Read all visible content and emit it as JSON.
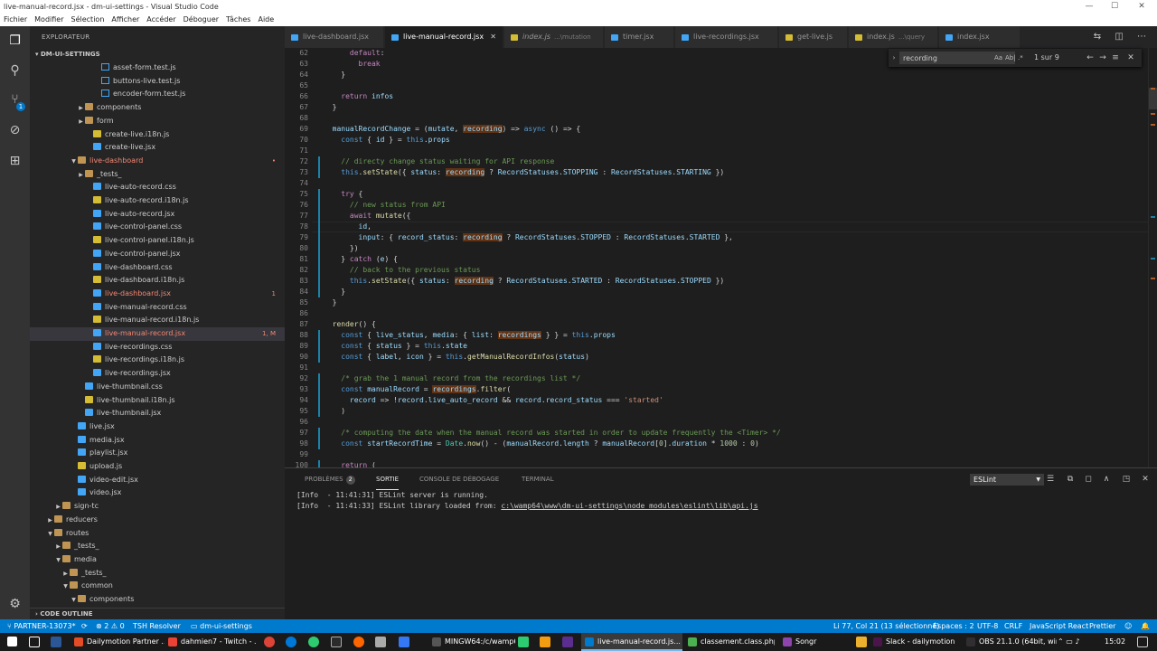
{
  "window": {
    "title": "live-manual-record.jsx - dm-ui-settings - Visual Studio Code",
    "minimize": "—",
    "maximize": "☐",
    "close": "✕"
  },
  "menu": [
    "Fichier",
    "Modifier",
    "Sélection",
    "Afficher",
    "Accéder",
    "Déboguer",
    "Tâches",
    "Aide"
  ],
  "activity": {
    "scm_badge": "1"
  },
  "sidebar": {
    "title": "EXPLORATEUR",
    "section": "DM-UI-SETTINGS",
    "outline": "CODE OUTLINE",
    "items": [
      {
        "label": "asset-form.test.js",
        "type": "test",
        "status": ""
      },
      {
        "label": "buttons-live.test.js",
        "type": "test",
        "status": ""
      },
      {
        "label": "encoder-form.test.js",
        "type": "test",
        "status": ""
      },
      {
        "label": "components",
        "type": "folder",
        "status": ""
      },
      {
        "label": "form",
        "type": "folder",
        "status": ""
      },
      {
        "label": "create-live.i18n.js",
        "type": "js",
        "status": ""
      },
      {
        "label": "create-live.jsx",
        "type": "css",
        "status": ""
      },
      {
        "label": "live-dashboard",
        "type": "folder",
        "status": "•"
      },
      {
        "label": "_tests_",
        "type": "folder",
        "status": ""
      },
      {
        "label": "live-auto-record.css",
        "type": "css",
        "status": ""
      },
      {
        "label": "live-auto-record.i18n.js",
        "type": "js",
        "status": ""
      },
      {
        "label": "live-auto-record.jsx",
        "type": "css",
        "status": ""
      },
      {
        "label": "live-control-panel.css",
        "type": "css",
        "status": ""
      },
      {
        "label": "live-control-panel.i18n.js",
        "type": "js",
        "status": ""
      },
      {
        "label": "live-control-panel.jsx",
        "type": "css",
        "status": ""
      },
      {
        "label": "live-dashboard.css",
        "type": "css",
        "status": ""
      },
      {
        "label": "live-dashboard.i18n.js",
        "type": "js",
        "status": ""
      },
      {
        "label": "live-dashboard.jsx",
        "type": "css",
        "status": "1"
      },
      {
        "label": "live-manual-record.css",
        "type": "css",
        "status": ""
      },
      {
        "label": "live-manual-record.i18n.js",
        "type": "js",
        "status": ""
      },
      {
        "label": "live-manual-record.jsx",
        "type": "css",
        "status": "1, M"
      },
      {
        "label": "live-recordings.css",
        "type": "css",
        "status": ""
      },
      {
        "label": "live-recordings.i18n.js",
        "type": "js",
        "status": ""
      },
      {
        "label": "live-recordings.jsx",
        "type": "css",
        "status": ""
      },
      {
        "label": "live-thumbnail.css",
        "type": "css",
        "status": ""
      },
      {
        "label": "live-thumbnail.i18n.js",
        "type": "js",
        "status": ""
      },
      {
        "label": "live-thumbnail.jsx",
        "type": "css",
        "status": ""
      },
      {
        "label": "live.jsx",
        "type": "css",
        "status": ""
      },
      {
        "label": "media.jsx",
        "type": "css",
        "status": ""
      },
      {
        "label": "playlist.jsx",
        "type": "css",
        "status": ""
      },
      {
        "label": "upload.js",
        "type": "js",
        "status": ""
      },
      {
        "label": "video-edit.jsx",
        "type": "css",
        "status": ""
      },
      {
        "label": "video.jsx",
        "type": "css",
        "status": ""
      },
      {
        "label": "sign-tc",
        "type": "folder",
        "status": ""
      },
      {
        "label": "reducers",
        "type": "folder",
        "status": ""
      },
      {
        "label": "routes",
        "type": "folder",
        "status": ""
      },
      {
        "label": "_tests_",
        "type": "folder",
        "status": ""
      },
      {
        "label": "media",
        "type": "folder",
        "status": ""
      },
      {
        "label": "_tests_",
        "type": "folder",
        "status": ""
      },
      {
        "label": "common",
        "type": "folder",
        "status": ""
      },
      {
        "label": "components",
        "type": "folder",
        "status": ""
      }
    ]
  },
  "tabs": [
    {
      "label": "live-dashboard.jsx",
      "desc": "",
      "active": false,
      "italic": false
    },
    {
      "label": "live-manual-record.jsx",
      "desc": "",
      "active": true,
      "italic": false
    },
    {
      "label": "index.js",
      "desc": "...\\mutation",
      "active": false,
      "italic": true
    },
    {
      "label": "timer.jsx",
      "desc": "",
      "active": false,
      "italic": false
    },
    {
      "label": "live-recordings.jsx",
      "desc": "",
      "active": false,
      "italic": false
    },
    {
      "label": "get-live.js",
      "desc": "",
      "active": false,
      "italic": false
    },
    {
      "label": "index.js",
      "desc": "...\\query",
      "active": false,
      "italic": false
    },
    {
      "label": "index.jsx",
      "desc": "",
      "active": false,
      "italic": false
    }
  ],
  "find": {
    "query": "recording",
    "opt_case": "Aa",
    "opt_word": "Ab|",
    "opt_regex": ".*",
    "count": "1 sur 9"
  },
  "editor": {
    "lines": [
      {
        "n": "62",
        "code": "      default:"
      },
      {
        "n": "63",
        "code": "        break"
      },
      {
        "n": "64",
        "code": "    }"
      },
      {
        "n": "65",
        "code": ""
      },
      {
        "n": "66",
        "code": "    return infos"
      },
      {
        "n": "67",
        "code": "  }"
      },
      {
        "n": "68",
        "code": ""
      },
      {
        "n": "69",
        "code": "  manualRecordChange = (mutate, recording) => async () => {"
      },
      {
        "n": "70",
        "code": "    const { id } = this.props"
      },
      {
        "n": "71",
        "code": ""
      },
      {
        "n": "72",
        "code": "    // directy change status waiting for API response"
      },
      {
        "n": "73",
        "code": "    this.setState({ status: recording ? RecordStatuses.STOPPING : RecordStatuses.STARTING })"
      },
      {
        "n": "74",
        "code": ""
      },
      {
        "n": "75",
        "code": "    try {"
      },
      {
        "n": "76",
        "code": "      // new status from API"
      },
      {
        "n": "77",
        "code": "      await mutate({"
      },
      {
        "n": "78",
        "code": "        id,"
      },
      {
        "n": "79",
        "code": "        input: { record_status: recording ? RecordStatuses.STOPPED : RecordStatuses.STARTED },"
      },
      {
        "n": "80",
        "code": "      })"
      },
      {
        "n": "81",
        "code": "    } catch (e) {"
      },
      {
        "n": "82",
        "code": "      // back to the previous status"
      },
      {
        "n": "83",
        "code": "      this.setState({ status: recording ? RecordStatuses.STARTED : RecordStatuses.STOPPED })"
      },
      {
        "n": "84",
        "code": "    }"
      },
      {
        "n": "85",
        "code": "  }"
      },
      {
        "n": "86",
        "code": ""
      },
      {
        "n": "87",
        "code": "  render() {"
      },
      {
        "n": "88",
        "code": "    const { live_status, media: { list: recordings } } = this.props"
      },
      {
        "n": "89",
        "code": "    const { status } = this.state"
      },
      {
        "n": "90",
        "code": "    const { label, icon } = this.getManualRecordInfos(status)"
      },
      {
        "n": "91",
        "code": ""
      },
      {
        "n": "92",
        "code": "    /* grab the 1 manual record from the recordings list */"
      },
      {
        "n": "93",
        "code": "    const manualRecord = recordings.filter("
      },
      {
        "n": "94",
        "code": "      record => !record.live_auto_record && record.record_status === 'started'"
      },
      {
        "n": "95",
        "code": "    )"
      },
      {
        "n": "96",
        "code": ""
      },
      {
        "n": "97",
        "code": "    /* computing the date when the manual record was started in order to update frequently the <Timer> */"
      },
      {
        "n": "98",
        "code": "    const startRecordTime = Date.now() - (manualRecord.length ? manualRecord[0].duration * 1000 : 0)"
      },
      {
        "n": "99",
        "code": ""
      },
      {
        "n": "100",
        "code": "    return ("
      }
    ]
  },
  "panel": {
    "tabs": [
      {
        "label": "PROBLÈMES",
        "badge": "2"
      },
      {
        "label": "SORTIE",
        "badge": ""
      },
      {
        "label": "CONSOLE DE DÉBOGAGE",
        "badge": ""
      },
      {
        "label": "TERMINAL",
        "badge": ""
      }
    ],
    "select": "ESLint",
    "output": [
      {
        "prefix": "[Info  - 11:41:31] ESLint server is running.",
        "link": ""
      },
      {
        "prefix": "[Info  - 11:41:33] ESLint library loaded from: ",
        "link": "c:\\wamp64\\www\\dm-ui-settings\\node_modules\\eslint\\lib\\api.js"
      }
    ]
  },
  "statusbar": {
    "branch": "PARTNER-13073*",
    "errors": "⊗ 2 ⚠ 0",
    "tsh": "TSH Resolver",
    "folder": "dm-ui-settings",
    "position": "Li 77, Col 21 (13 sélectionné)",
    "spaces": "Espaces : 2",
    "encoding": "UTF-8",
    "eol": "CRLF",
    "language": "JavaScript React",
    "prettier": "Prettier",
    "smiley": "☺",
    "bell": "🔔"
  },
  "taskbar": {
    "items": [
      {
        "label": "Dailymotion Partner ...",
        "color": "#e34c26"
      },
      {
        "label": "dahmien7 - Twitch - ...",
        "color": "#ea4335"
      },
      {
        "label": "MINGW64:/c/wamp6...",
        "color": "#555555"
      },
      {
        "label": "live-manual-record.js...",
        "color": "#007acc"
      },
      {
        "label": "classement.class.php...",
        "color": "#4caf50"
      },
      {
        "label": "Songr",
        "color": "#8e44ad"
      },
      {
        "label": "Slack - dailymotion",
        "color": "#4a154b"
      },
      {
        "label": "OBS 21.1.0 (64bit, win...",
        "color": "#302e31"
      }
    ],
    "time": "15:02"
  }
}
